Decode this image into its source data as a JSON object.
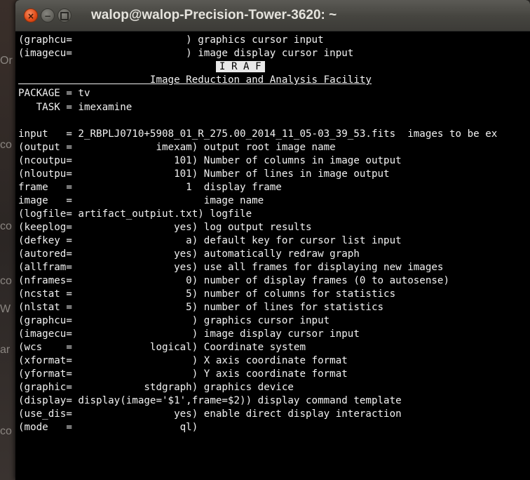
{
  "window": {
    "title": "walop@walop-Precision-Tower-3620: ~",
    "close_glyph": "×",
    "minimize_glyph": "−"
  },
  "background_fragments": [
    "Or",
    "co",
    "co",
    "co",
    "W",
    "ar",
    "co"
  ],
  "terminal": {
    "lines": [
      "(graphcu=                   ) graphics cursor input",
      "(imagecu=                   ) image display cursor input",
      "",
      "                      Image Reduction and Analysis Facility",
      "PACKAGE = tv",
      "   TASK = imexamine",
      "",
      "input   = 2_RBPLJ0710+5908_01_R_275.00_2014_11_05-03_39_53.fits  images to be ex",
      "(output =              imexam) output root image name",
      "(ncoutpu=                 101) Number of columns in image output",
      "(nloutpu=                 101) Number of lines in image output",
      "frame   =                   1  display frame",
      "image   =                      image name",
      "(logfile= artifact_outpiut.txt) logfile",
      "(keeplog=                 yes) log output results",
      "(defkey =                   a) default key for cursor list input",
      "(autored=                 yes) automatically redraw graph",
      "(allfram=                 yes) use all frames for displaying new images",
      "(nframes=                   0) number of display frames (0 to autosense)",
      "(ncstat =                   5) number of columns for statistics",
      "(nlstat =                   5) number of lines for statistics",
      "(graphcu=                    ) graphics cursor input",
      "(imagecu=                    ) image display cursor input",
      "(wcs    =             logical) Coordinate system",
      "(xformat=                    ) X axis coordinate format",
      "(yformat=                    ) Y axis coordinate format",
      "(graphic=            stdgraph) graphics device",
      "(display= display(image='$1',frame=$2)) display command template",
      "(use_dis=                 yes) enable direct display interaction",
      "(mode   =                  ql)"
    ],
    "iraf_banner": "I R A F",
    "iraf_prefix": "                                 "
  }
}
